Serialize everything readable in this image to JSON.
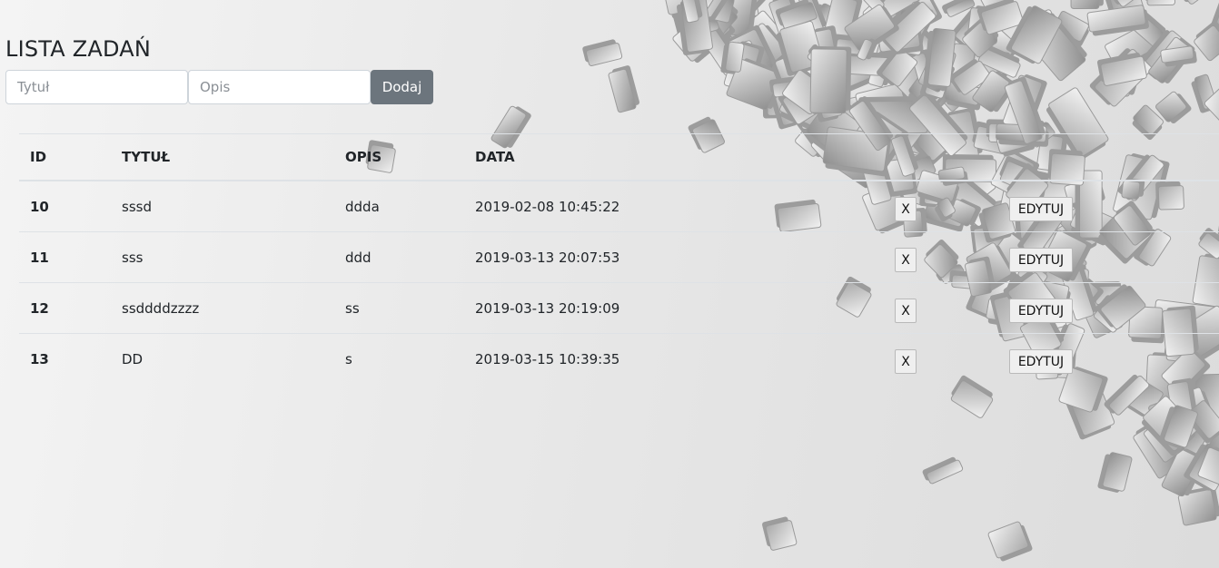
{
  "page": {
    "title": "LISTA ZADAŃ"
  },
  "form": {
    "title_placeholder": "Tytuł",
    "description_placeholder": "Opis",
    "add_label": "Dodaj"
  },
  "table": {
    "headers": {
      "id": "ID",
      "title": "TYTUŁ",
      "description": "OPIS",
      "date": "DATA"
    },
    "rows": [
      {
        "id": "10",
        "title": "sssd",
        "description": "ddda",
        "date": "2019-02-08 10:45:22",
        "delete_label": "X",
        "edit_label": "EDYTUJ"
      },
      {
        "id": "11",
        "title": "sss",
        "description": "ddd",
        "date": "2019-03-13 20:07:53",
        "delete_label": "X",
        "edit_label": "EDYTUJ"
      },
      {
        "id": "12",
        "title": "ssddddzzzz",
        "description": "ss",
        "date": "2019-03-13 20:19:09",
        "delete_label": "X",
        "edit_label": "EDYTUJ"
      },
      {
        "id": "13",
        "title": "DD",
        "description": "s",
        "date": "2019-03-15 10:39:35",
        "delete_label": "X",
        "edit_label": "EDYTUJ"
      }
    ]
  },
  "colors": {
    "add_button_bg": "#6c757d",
    "table_border": "#dee2e6",
    "text": "#212529"
  }
}
